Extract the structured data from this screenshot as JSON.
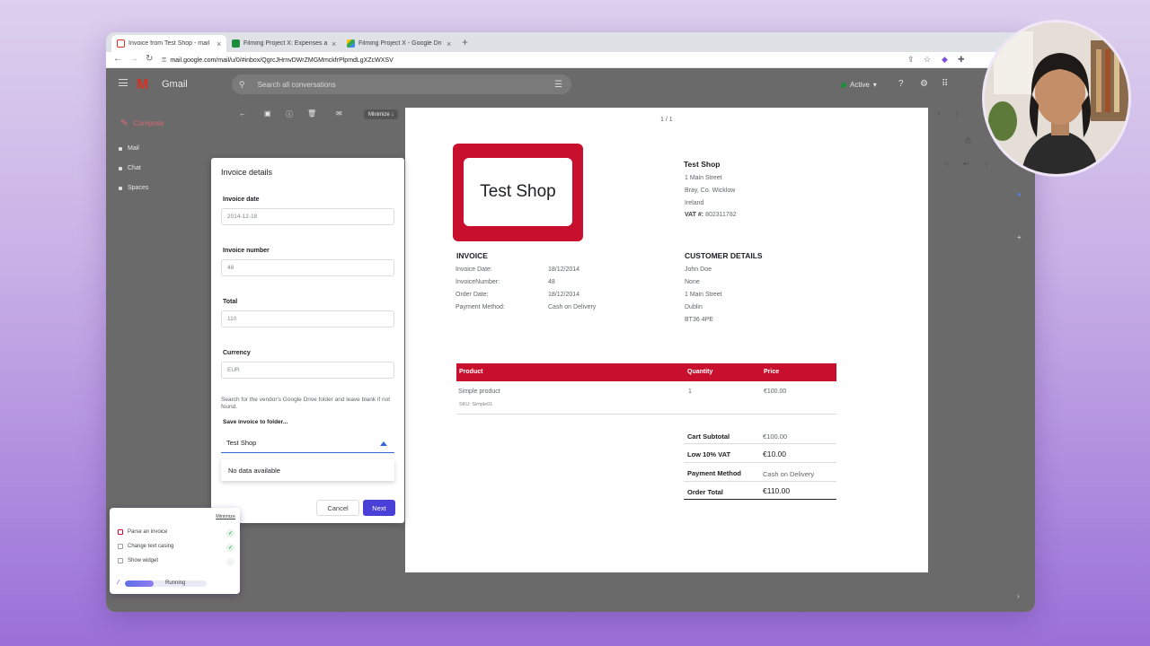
{
  "browser": {
    "tabs": [
      {
        "title": "Invoice from Test Shop - mail",
        "active": true,
        "favicon": "gmail-icon"
      },
      {
        "title": "Filming Project X: Expenses a",
        "active": false,
        "favicon": "sheets-icon"
      },
      {
        "title": "Filming Project X - Google Dri",
        "active": false,
        "favicon": "drive-icon"
      }
    ],
    "url": "mail.google.com/mail/u/0/#inbox/QgrcJHrnvDWrZMGMmckfrPlpmdLgXZcWXSV"
  },
  "gmail": {
    "logo": "M",
    "app_name": "Gmail",
    "search_placeholder": "Search all conversations",
    "status": "Active",
    "compose": "Compose",
    "nav": [
      "Mail",
      "Chat",
      "Spaces"
    ],
    "minimize_label": "Minimize ↓"
  },
  "invoice_panel": {
    "title": "Invoice details",
    "fields": [
      {
        "label": "Invoice date",
        "value": "2014-12-18"
      },
      {
        "label": "Invoice number",
        "value": "48"
      },
      {
        "label": "Total",
        "value": "110"
      },
      {
        "label": "Currency",
        "value": "EUR"
      }
    ],
    "help_text": "Search for the vendor's Google Drive folder and leave blank if not found.",
    "folder_label": "Save invoice to folder...",
    "folder_value": "Test Shop",
    "dropdown_text": "No data available",
    "cancel": "Cancel",
    "next": "Next"
  },
  "pdf": {
    "page_count": "1 / 1",
    "logo_text": "Test Shop",
    "shop": {
      "name": "Test Shop",
      "lines": [
        "1 Main Street",
        "Bray, Co. Wicklow",
        "Ireland"
      ],
      "vat_label": "VAT #:",
      "vat_value": "802311782"
    },
    "invoice_title": "INVOICE",
    "invoice_rows": [
      {
        "label": "Invoice Date:",
        "value": "18/12/2014"
      },
      {
        "label": "InvoiceNumber:",
        "value": "48"
      },
      {
        "label": "Order Date:",
        "value": "18/12/2014"
      },
      {
        "label": "Payment Method:",
        "value": "Cash on Delivery"
      }
    ],
    "customer_title": "CUSTOMER DETAILS",
    "customer_lines": [
      "John Doe",
      "None",
      "1 Main Street",
      "Dublin",
      "BT36 4PE"
    ],
    "table": {
      "headers": [
        "Product",
        "Quantity",
        "Price"
      ],
      "rows": [
        {
          "product": "Simple product",
          "sku": "SKU: Simple01",
          "quantity": "1",
          "price": "€100.00"
        }
      ]
    },
    "totals": [
      {
        "label": "Cart Subtotal",
        "value": "€100.00"
      },
      {
        "label": "Low 10% VAT",
        "value": "€10.00"
      },
      {
        "label": "Payment Method",
        "value": "Cash on Delivery"
      },
      {
        "label": "Order Total",
        "value": "€110.00"
      }
    ]
  },
  "widget": {
    "minimize": "Minimize",
    "steps": [
      {
        "label": "Parse an invoice",
        "done": true
      },
      {
        "label": "Change text casing",
        "done": true
      },
      {
        "label": "Show widget",
        "done": false
      }
    ],
    "status": "Running",
    "progress": 0.35
  },
  "colors": {
    "brand_red": "#c8102e",
    "next_button": "#4a3fd6",
    "focus_blue": "#3367d6"
  }
}
